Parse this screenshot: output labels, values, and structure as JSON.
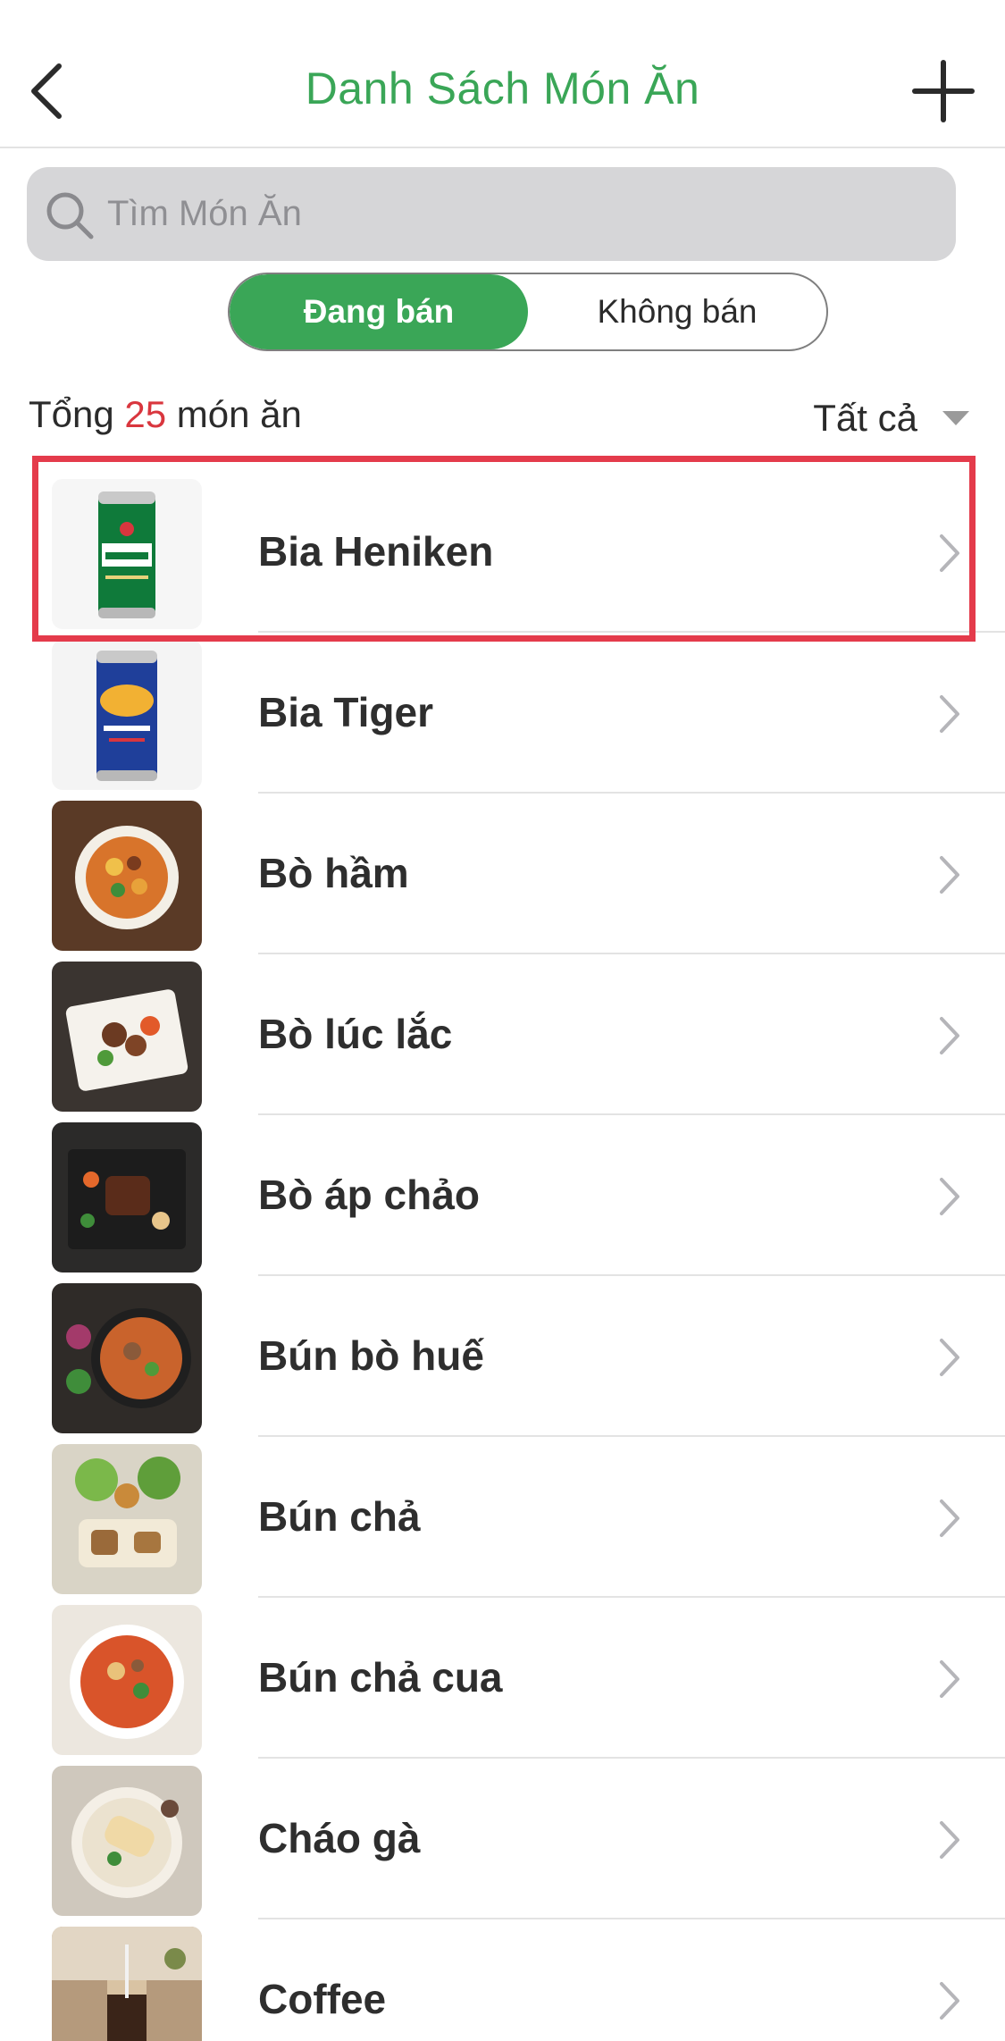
{
  "header": {
    "title": "Danh Sách Món Ăn",
    "back_icon": "chevron-left-icon",
    "add_icon": "plus-icon"
  },
  "search": {
    "placeholder": "Tìm Món Ăn",
    "value": "",
    "icon": "search-icon"
  },
  "segments": {
    "selling": "Đang bán",
    "not_selling": "Không bán",
    "active": "selling"
  },
  "summary": {
    "prefix": "Tổng",
    "count": "25",
    "suffix": "món ăn"
  },
  "filter": {
    "label": "Tất cả"
  },
  "items": [
    {
      "name": "Bia Heniken",
      "thumb": "heineken-can"
    },
    {
      "name": "Bia Tiger",
      "thumb": "tiger-can"
    },
    {
      "name": "Bò hầm",
      "thumb": "beef-stew"
    },
    {
      "name": "Bò lúc lắc",
      "thumb": "shaking-beef"
    },
    {
      "name": "Bò áp chảo",
      "thumb": "pan-seared-beef"
    },
    {
      "name": "Bún bò huế",
      "thumb": "bun-bo-hue"
    },
    {
      "name": "Bún chả",
      "thumb": "bun-cha"
    },
    {
      "name": "Bún chả cua",
      "thumb": "bun-cha-cua"
    },
    {
      "name": "Cháo gà",
      "thumb": "chicken-porridge"
    },
    {
      "name": "Coffee",
      "thumb": "iced-coffee"
    }
  ],
  "colors": {
    "accent": "#3aa657",
    "count": "#d9363e",
    "highlight": "#e43b4b",
    "search_bg": "#d6d6d8"
  }
}
